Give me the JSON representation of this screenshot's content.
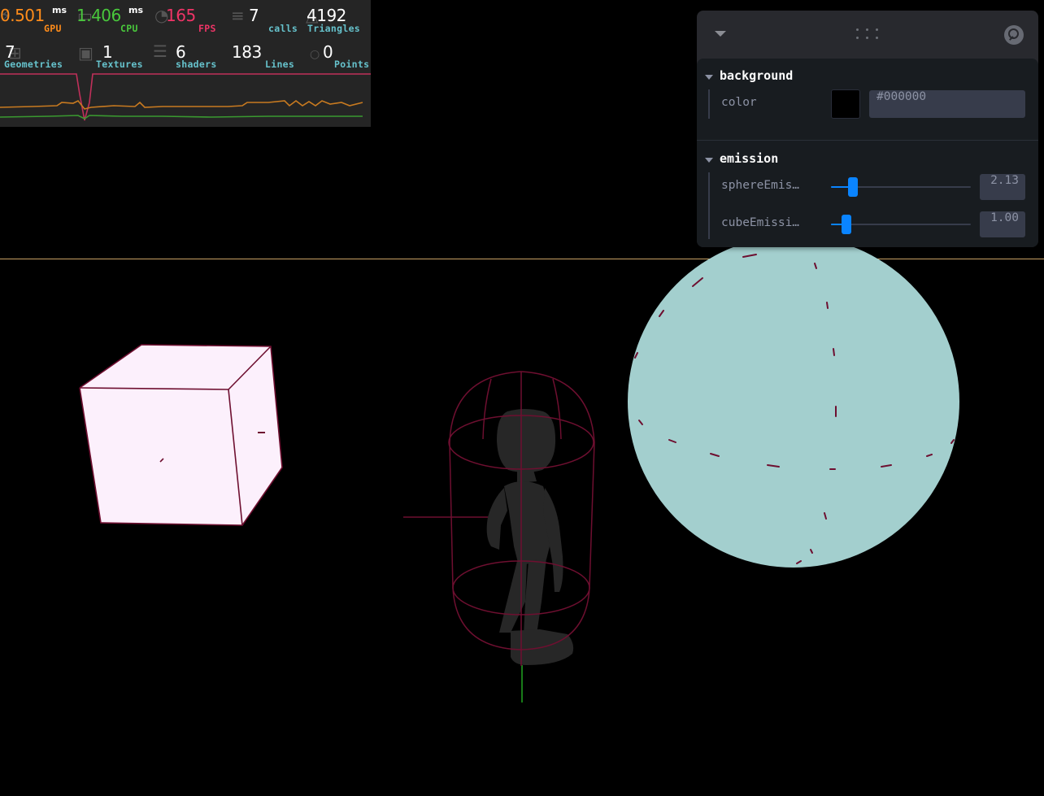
{
  "stats": {
    "gpu": {
      "value": "0.501",
      "unit": "ms",
      "label": "GPU",
      "color": "#ff8c1a"
    },
    "cpu": {
      "value": "1.406",
      "unit": "ms",
      "label": "CPU",
      "color": "#49c83c"
    },
    "fps": {
      "value": "165",
      "label": "FPS",
      "color": "#ee3466"
    },
    "calls": {
      "value": "7",
      "label": "calls",
      "color": "#66c2cc"
    },
    "triangles": {
      "value": "4192",
      "label": "Triangles",
      "color": "#66c2cc"
    },
    "geometries": {
      "value": "7",
      "label": "Geometries",
      "color": "#66c2cc"
    },
    "textures": {
      "value": "1",
      "label": "Textures",
      "color": "#66c2cc"
    },
    "shaders": {
      "value": "6",
      "label": "shaders",
      "color": "#66c2cc"
    },
    "lines": {
      "value": "183",
      "label": "Lines",
      "color": "#66c2cc"
    },
    "points": {
      "value": "0",
      "label": "Points",
      "color": "#66c2cc"
    }
  },
  "panel": {
    "folders": [
      {
        "title": "background",
        "rows": [
          {
            "label": "color",
            "value": "#000000",
            "swatch": "#000000"
          }
        ]
      },
      {
        "title": "emission",
        "rows": [
          {
            "label": "sphereEmis…",
            "value": "2.13",
            "fraction": 0.13
          },
          {
            "label": "cubeEmissi…",
            "value": "1.00",
            "fraction": 0.08
          }
        ]
      }
    ]
  },
  "scene": {
    "cube_color": "#fcf0fc",
    "sphere_color": "#a3cfce",
    "character_color": "#272727",
    "wire_color": "#6e0f30",
    "horizon_color": "#c8a064"
  }
}
